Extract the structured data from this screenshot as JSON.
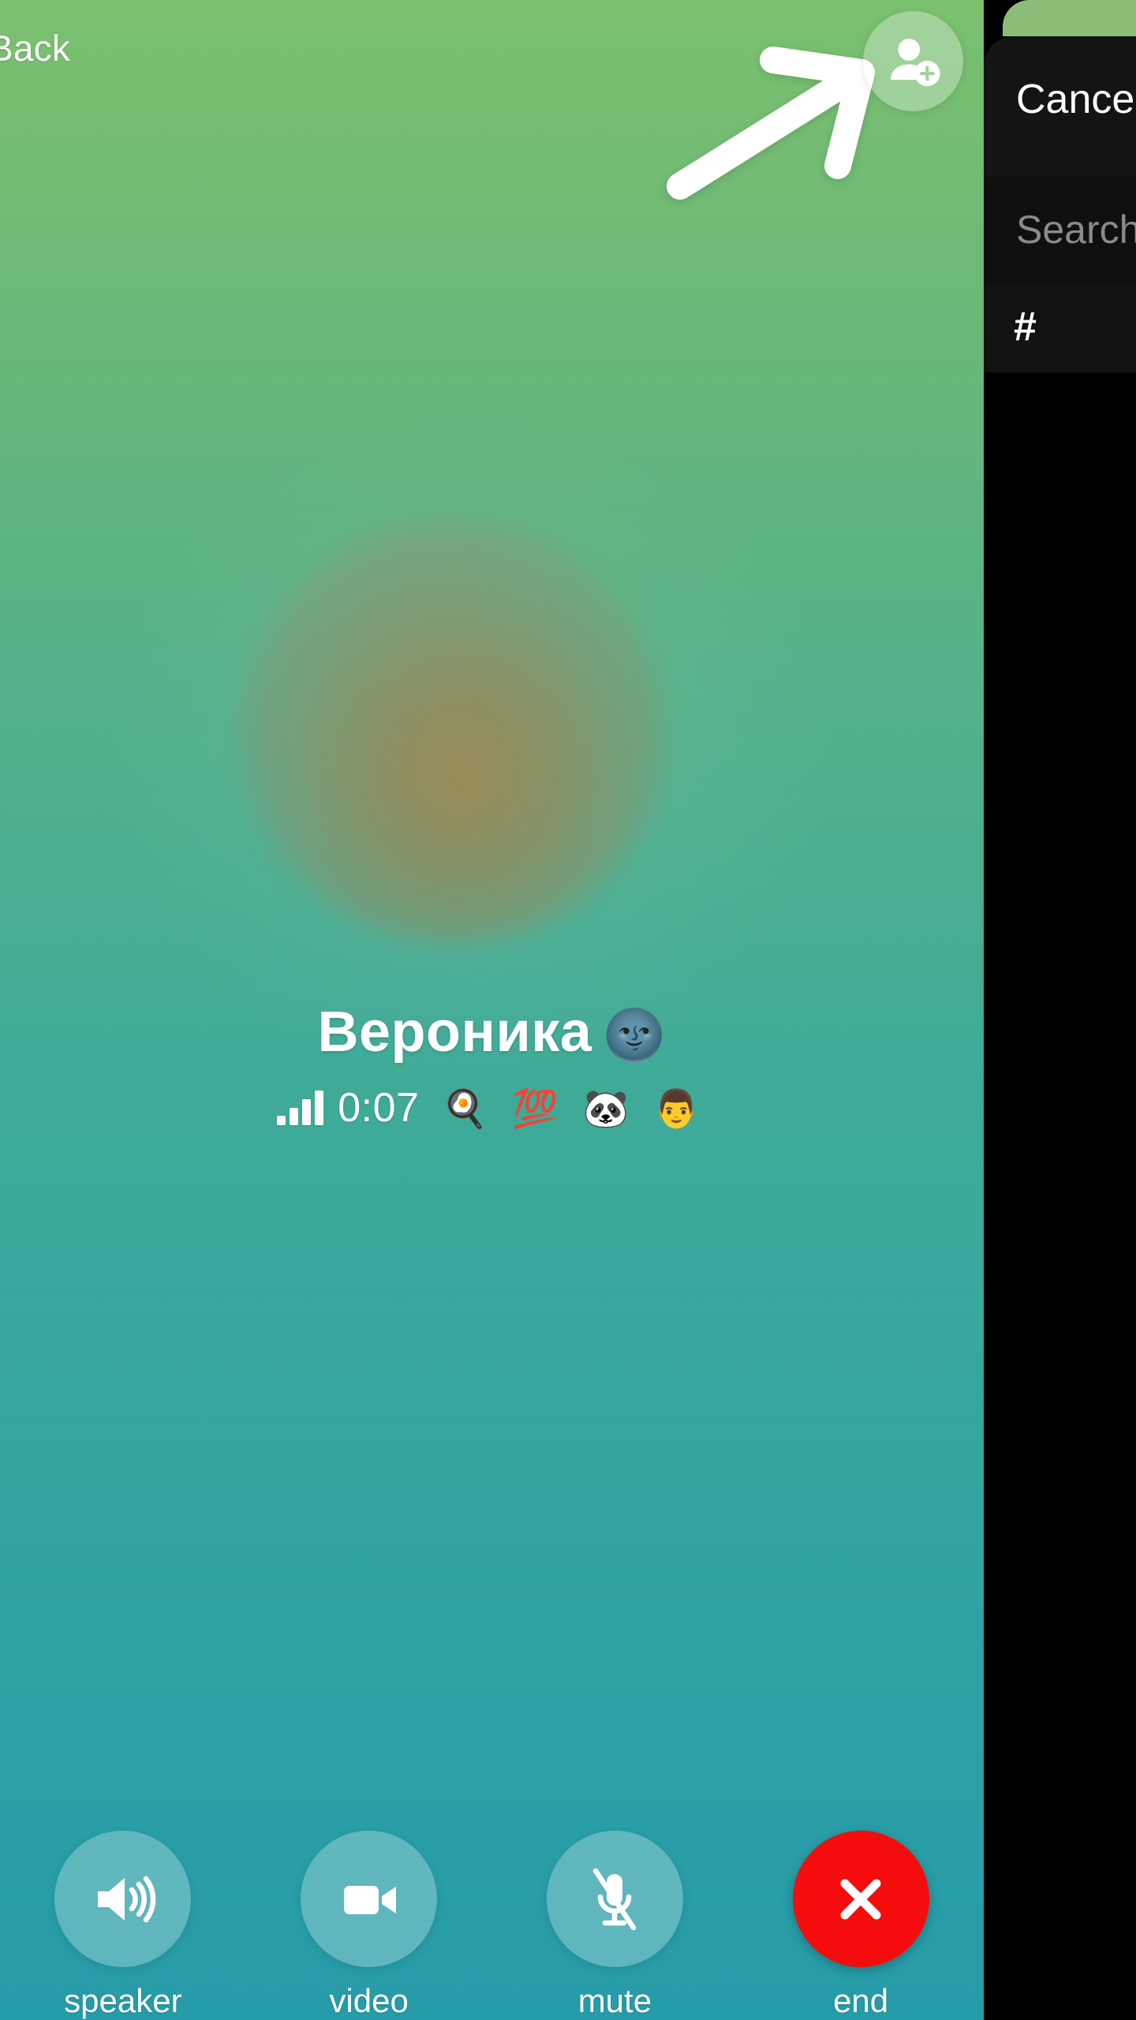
{
  "call": {
    "back_label": "Back",
    "add_participant_icon": "person-add-icon",
    "pointer_arrow_icon": "arrow-up-right-icon",
    "avatar": "blurred-contact-photo",
    "caller_name": "Вероника",
    "name_emoji": "🌚",
    "duration": "0:07",
    "signal_icon": "signal-bars-icon",
    "status_emojis": "🍳 💯 🐼 👨",
    "controls": [
      {
        "id": "speaker",
        "label": "speaker",
        "icon": "speaker-waves-icon",
        "style": "light"
      },
      {
        "id": "video",
        "label": "video",
        "icon": "video-camera-icon",
        "style": "light"
      },
      {
        "id": "mute",
        "label": "mute",
        "icon": "microphone-muted-icon",
        "style": "light"
      },
      {
        "id": "end",
        "label": "end",
        "icon": "close-x-icon",
        "style": "danger"
      }
    ]
  },
  "add_participant_sheet": {
    "cancel_label": "Cancel",
    "search_placeholder": "Search",
    "section_letter": "#"
  },
  "colors": {
    "gradient_top": "#7bc06f",
    "gradient_bottom": "#279ca9",
    "end_call_red": "#f50c0c",
    "control_fill": "rgba(255,255,255,0.26)",
    "sheet_background": "#111111",
    "sheet_peek_green": "#8bbd79"
  }
}
